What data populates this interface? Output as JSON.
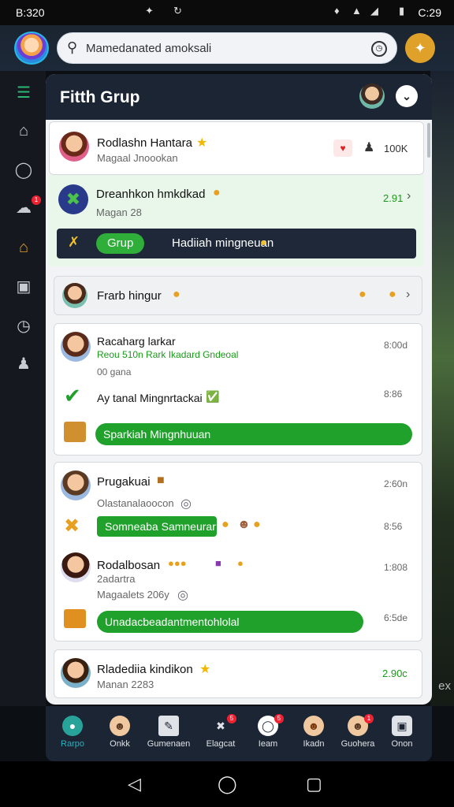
{
  "status": {
    "left_time": "B:320",
    "right_time": "C:29"
  },
  "search": {
    "placeholder": "Mamedanated amoksali"
  },
  "panel": {
    "title": "Fitth Grup",
    "cards": {
      "c1": {
        "name": "Rodlashn Hantara",
        "sub": "Magaal Jnoookan",
        "count": "100K"
      },
      "c2": {
        "name": "Dreanhkon hmkdkad",
        "sub": "Magan 28",
        "time": "2.91",
        "banner_pill": "Grup",
        "banner_text": "Hadiiah mingneuan"
      },
      "c3": {
        "name": "Frarb hingur"
      },
      "c4": {
        "name": "Racaharg larkar",
        "green": "Reou 510n Rark Ikadard Gndeoal",
        "sub": "00 gana",
        "time": "8:00d",
        "line2": "Ay tanal Mingnrtackai",
        "time2": "8:86",
        "pill": "Sparkiah Mingnhuuan"
      },
      "c5": {
        "name": "Prugakuai",
        "sub": "Olastanalaoocon",
        "time": "2:60n",
        "pill": "Somneaba Samneurar",
        "time2": "8:56",
        "name2": "Rodalbosan",
        "sub2a": "2adartra",
        "sub2b": "Magaalets 206y",
        "time3": "1:808",
        "pill2": "Unadacbeadantmentohlolal",
        "time4": "6:5de"
      },
      "c6": {
        "name": "Rladediia kindikon",
        "sub": "Manan 2283",
        "time": "2.90c"
      }
    }
  },
  "nav": [
    {
      "label": "Rarpo",
      "icon": "group-icon",
      "active": true
    },
    {
      "label": "Onkk",
      "icon": "profile-icon"
    },
    {
      "label": "Gumenaen",
      "icon": "edit-icon"
    },
    {
      "label": "Elagcat",
      "icon": "flag-icon",
      "badge": "5"
    },
    {
      "label": "Ieam",
      "icon": "team-icon",
      "badge": "5"
    },
    {
      "label": "Ikadn",
      "icon": "person-icon"
    },
    {
      "label": "Guohera",
      "icon": "user-icon",
      "badge": "1"
    },
    {
      "label": "Onon",
      "icon": "shop-icon"
    }
  ],
  "side_badge": "1",
  "bg_edge_text": "ex",
  "colors": {
    "accent": "#1fa12b",
    "header": "#1c2533",
    "action": "#e0a12a"
  }
}
